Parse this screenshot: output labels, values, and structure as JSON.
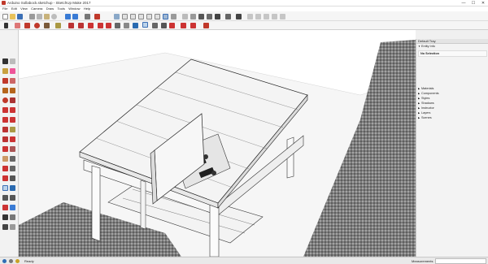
{
  "window": {
    "title": "Arduino Sollabock.sketchup - SketchUp Make 2017",
    "controls": [
      "—",
      "☐",
      "✕"
    ]
  },
  "menu": [
    "File",
    "Edit",
    "View",
    "Camera",
    "Draw",
    "Tools",
    "Window",
    "Help"
  ],
  "toolbar": {
    "row1_icons": [
      "new-icon",
      "open-icon",
      "save-icon",
      "cut-icon",
      "copy-icon",
      "paste-icon",
      "erase-icon",
      "undo-icon",
      "redo-icon",
      "print-icon",
      "model-info-icon",
      "iso-icon",
      "top-icon",
      "front-icon",
      "right-icon",
      "back-icon",
      "left-icon",
      "bottom-icon",
      "xray-icon",
      "wireframe-icon",
      "hidden-line-icon",
      "shaded-icon",
      "textured-icon",
      "monochrome-icon",
      "warehouse-icon",
      "extension-icon",
      "layout-icon",
      "components-icon",
      "materials-icon",
      "styles-icon",
      "layers-icon",
      "outliner-icon",
      "scenes-icon",
      "shadows-icon"
    ],
    "row2_icons": [
      "select-icon",
      "eraser-icon",
      "pencil-icon",
      "arc-icon",
      "rectangle-icon",
      "push-pull-icon",
      "move-icon",
      "rotate-icon",
      "scale-icon",
      "offset-icon",
      "tape-icon",
      "text-icon",
      "paint-icon",
      "orbit-icon",
      "pan-icon",
      "zoom-icon",
      "zoom-extents-icon",
      "add-location-icon",
      "terrain-icon",
      "sandbox-icon",
      "ruby-icon"
    ]
  },
  "tray": {
    "header": "Default Tray",
    "entity_info_label": "Entity Info",
    "entity_value": "No Selection",
    "panels": [
      "Materials",
      "Components",
      "Styles",
      "Shadows",
      "Instructor",
      "Layers",
      "Scenes"
    ]
  },
  "status": {
    "ready": "Ready",
    "measurements_label": "Measurements",
    "measurements_value": ""
  },
  "colors": {
    "accent": "#2f6db5",
    "carpet": "#8a8a8a",
    "wood": "#f2f2f2"
  }
}
